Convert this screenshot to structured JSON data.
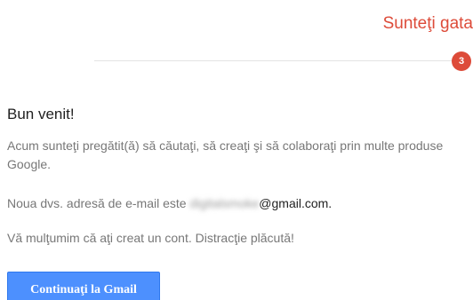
{
  "header": {
    "step_title": "Sunteţi gata",
    "step_number": "3"
  },
  "colors": {
    "accent_red": "#dd4b39",
    "button_blue": "#4d90fe",
    "body_text": "#777777"
  },
  "welcome": {
    "heading": "Bun venit!",
    "intro": "Acum sunteţi pregătit(ă) să căutaţi, să creaţi şi să colaboraţi prin multe produse Google.",
    "email_prefix": "Noua dvs. adresă de e-mail este ",
    "email_user": "digitalsmoke",
    "email_domain": "@gmail.com",
    "email_suffix": ".",
    "thanks": "Vă mulţumim că aţi creat un cont. Distracţie plăcută!"
  },
  "actions": {
    "continue_label": "Continuaţi la Gmail"
  }
}
